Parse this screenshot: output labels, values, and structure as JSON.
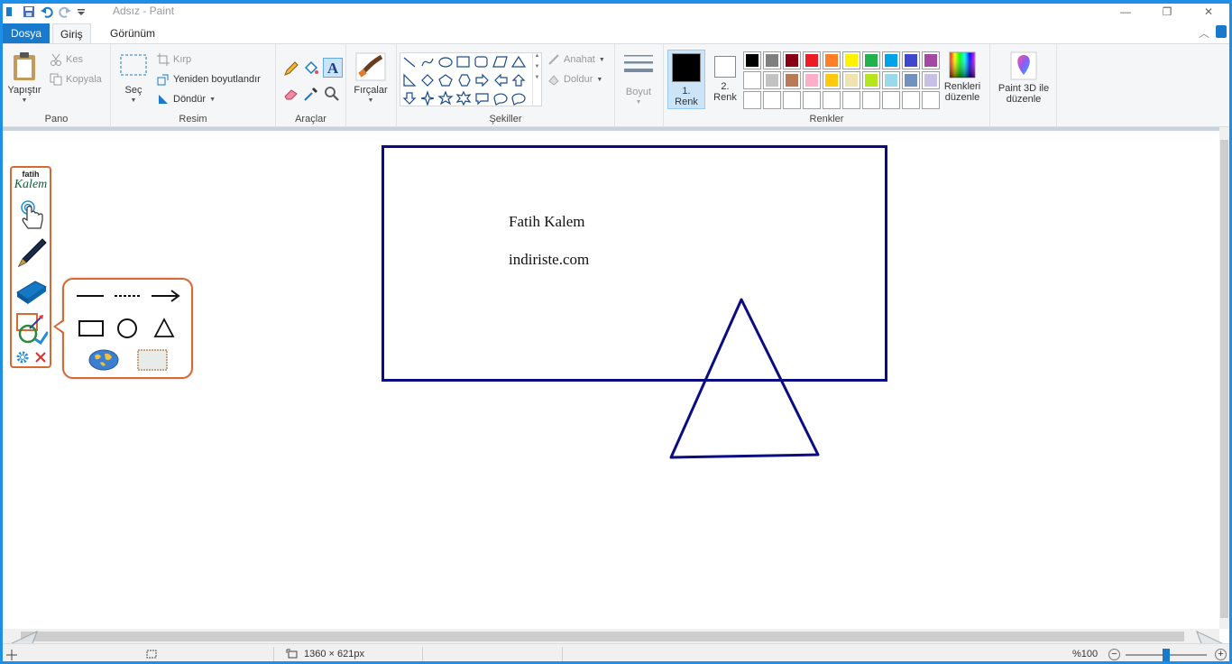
{
  "window": {
    "title": "Adsız - Paint",
    "controls": {
      "minimize": "—",
      "maximize": "❐",
      "close": "✕"
    }
  },
  "tabs": [
    {
      "label": "Dosya"
    },
    {
      "label": "Giriş"
    },
    {
      "label": "Görünüm"
    }
  ],
  "ribbon": {
    "pano": {
      "label": "Pano",
      "paste": "Yapıştır",
      "cut": "Kes",
      "copy": "Kopyala"
    },
    "resim": {
      "label": "Resim",
      "select": "Seç",
      "crop": "Kırp",
      "resize": "Yeniden boyutlandır",
      "rotate": "Döndür"
    },
    "araclar": {
      "label": "Araçlar"
    },
    "brushes": {
      "label": "Fırçalar"
    },
    "sekiller": {
      "label": "Şekiller",
      "outline": "Anahat",
      "fill": "Doldur"
    },
    "size": {
      "label": "Boyut"
    },
    "renkler": {
      "label": "Renkler",
      "color1": "1. Renk",
      "color1_line1": "1.",
      "color1_line2": "Renk",
      "color2_line1": "2.",
      "color2_line2": "Renk",
      "color1_value": "#000000",
      "color2_value": "#ffffff",
      "edit_colors_line1": "Renkleri",
      "edit_colors_line2": "düzenle",
      "palette_row1": [
        "#000000",
        "#7f7f7f",
        "#880015",
        "#ed1c24",
        "#ff7f27",
        "#fff200",
        "#22b14c",
        "#00a2e8",
        "#3f48cc",
        "#a349a4"
      ],
      "palette_row2": [
        "#ffffff",
        "#c3c3c3",
        "#b97a57",
        "#ffaec9",
        "#ffc90e",
        "#efe4b0",
        "#b5e61d",
        "#99d9ea",
        "#7092be",
        "#c8bfe7"
      ]
    },
    "paint3d": {
      "line1": "Paint 3D ile",
      "line2": "düzenle"
    }
  },
  "canvas": {
    "text_line1": "Fatih Kalem",
    "text_line2": "indiriste.com",
    "stroke_color": "#0a0c84"
  },
  "statusbar": {
    "dimensions": "1360 × 621px",
    "zoom": "%100"
  },
  "fatih_kalem": {
    "logo_top": "fatih",
    "logo_bottom": "Kalem",
    "accent": "#d56a35"
  }
}
